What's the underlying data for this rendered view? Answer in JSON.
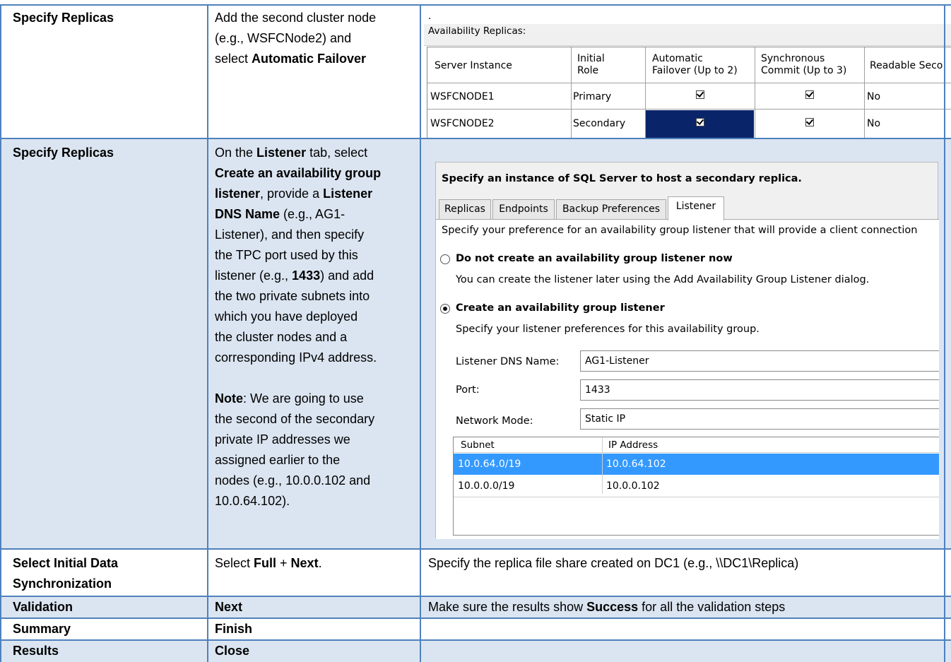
{
  "rows": [
    {
      "step": "Specify Replicas",
      "action_lines": [
        "Add the second cluster node",
        "(e.g., WSFCNode2) and"
      ],
      "action_tail_prefix": "select ",
      "action_tail_bold": "Automatic Failover",
      "dot": "."
    },
    {
      "step": "Specify Replicas",
      "action_html_lines": [
        [
          {
            "t": "On the "
          },
          {
            "t": "Listener",
            "b": true
          },
          {
            "t": " tab, select"
          }
        ],
        [
          {
            "t": "Create an availability group",
            "b": true
          }
        ],
        [
          {
            "t": "listener",
            "b": true
          },
          {
            "t": ", provide a "
          },
          {
            "t": "Listener",
            "b": true
          }
        ],
        [
          {
            "t": "DNS Name",
            "b": true
          },
          {
            "t": " (e.g., AG1-"
          }
        ],
        [
          {
            "t": "Listener), and then specify"
          }
        ],
        [
          {
            "t": "the TPC port used by this"
          }
        ],
        [
          {
            "t": "listener (e.g., "
          },
          {
            "t": "1433",
            "b": true
          },
          {
            "t": ") and add"
          }
        ],
        [
          {
            "t": "the two private subnets into"
          }
        ],
        [
          {
            "t": "which you have deployed"
          }
        ],
        [
          {
            "t": "the cluster nodes and a"
          }
        ],
        [
          {
            "t": "corresponding IPv4 address."
          }
        ],
        [
          {
            "t": ""
          }
        ],
        [
          {
            "t": "Note",
            "b": true
          },
          {
            "t": ": We are going to use"
          }
        ],
        [
          {
            "t": "the second of the secondary"
          }
        ],
        [
          {
            "t": "private IP addresses we"
          }
        ],
        [
          {
            "t": "assigned earlier to the"
          }
        ],
        [
          {
            "t": "nodes (e.g., 10.0.0.102 and"
          }
        ],
        [
          {
            "t": "10.0.64.102)."
          }
        ]
      ]
    },
    {
      "step_lines": [
        "Select Initial Data",
        "Synchronization"
      ],
      "action_prefix": "Select ",
      "action_bold1": "Full",
      "action_mid": " + ",
      "action_bold2": "Next",
      "action_suffix": ".",
      "note": "Specify the replica file share created on DC1 (e.g., \\\\DC1\\Replica)"
    },
    {
      "step": "Validation",
      "action": "Next",
      "note_prefix": "Make sure the results show ",
      "note_bold": "Success",
      "note_suffix": " for all the validation steps"
    },
    {
      "step": "Summary",
      "action": "Finish"
    },
    {
      "step": "Results",
      "action": "Close"
    }
  ],
  "replicas_grid": {
    "title": "Availability Replicas:",
    "headers": [
      "Server Instance",
      "Initial\nRole",
      "Automatic\nFailover (Up to 2)",
      "Synchronous\nCommit (Up to 3)",
      "Readable Seco"
    ],
    "rows": [
      {
        "server": "WSFCNODE1",
        "role": "Primary",
        "auto_failover": true,
        "sync_commit": true,
        "readable": "No"
      },
      {
        "server": "WSFCNODE2",
        "role": "Secondary",
        "auto_failover": true,
        "sync_commit": true,
        "readable": "No"
      }
    ]
  },
  "listener_dialog": {
    "heading": "Specify an instance of SQL Server to host a secondary replica.",
    "tabs": [
      "Replicas",
      "Endpoints",
      "Backup Preferences",
      "Listener"
    ],
    "active_tab": "Listener",
    "intro": "Specify your preference for an availability group listener that will provide a client connection",
    "option1_label": "Do not create an availability group listener now",
    "option1_desc": "You can create the listener later using the Add Availability Group Listener dialog.",
    "option2_label": "Create an availability group listener",
    "option2_desc": "Specify your listener preferences for this availability group.",
    "selected_option": 2,
    "dns_label": "Listener DNS Name:",
    "dns_value": "AG1-Listener",
    "port_label": "Port:",
    "port_value": "1433",
    "mode_label": "Network Mode:",
    "mode_value": "Static IP",
    "subnet_headers": [
      "Subnet",
      "IP Address"
    ],
    "subnets": [
      {
        "subnet": "10.0.64.0/19",
        "ip": "10.0.64.102",
        "selected": true
      },
      {
        "subnet": "10.0.0.0/19",
        "ip": "10.0.0.102",
        "selected": false
      }
    ]
  },
  "colors": {
    "border": "#4f81bd",
    "shade": "#dbe5f1",
    "selection": "#3399ff",
    "dark_cell": "#0a246a"
  }
}
